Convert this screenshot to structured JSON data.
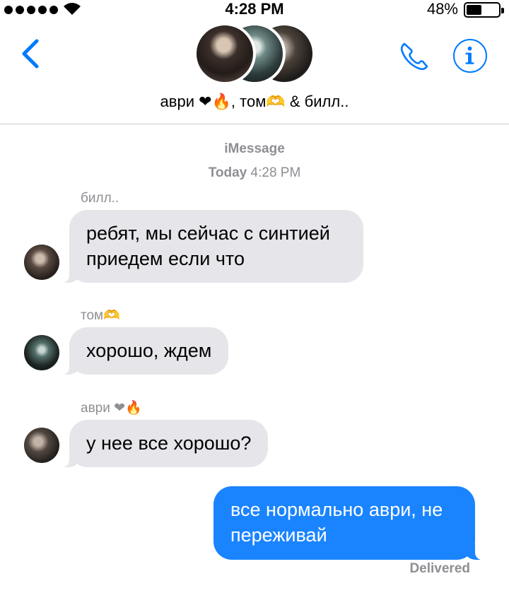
{
  "status_bar": {
    "time": "4:28 PM",
    "battery_percent": "48%",
    "battery_level": 0.48,
    "signal_bars": 5,
    "icons": [
      "signal-icon",
      "wifi-icon",
      "battery-icon"
    ]
  },
  "header": {
    "group_name": "аври ❤🔥, том🫶 & билл..",
    "icons": [
      "back-chevron-icon",
      "phone-icon",
      "info-icon"
    ]
  },
  "conversation": {
    "service": "iMessage",
    "timestamp_day": "Today",
    "timestamp_time": "4:28 PM",
    "messages": [
      {
        "sender": "билл..",
        "text": "ребят, мы сейчас с синтией приедем если что",
        "direction": "incoming"
      },
      {
        "sender": "том🫶",
        "text": "хорошо, ждем",
        "direction": "incoming"
      },
      {
        "sender": "аври ❤🔥",
        "text": "у нее все хорошо?",
        "direction": "incoming"
      },
      {
        "sender": "",
        "text": "все нормально аври, не переживай",
        "direction": "outgoing"
      }
    ],
    "delivered_label": "Delivered"
  },
  "colors": {
    "ios_blue": "#007aff",
    "outgoing_bubble": "#1a84ff",
    "incoming_bubble": "#e5e5ea",
    "secondary_text": "#8e8e93"
  }
}
